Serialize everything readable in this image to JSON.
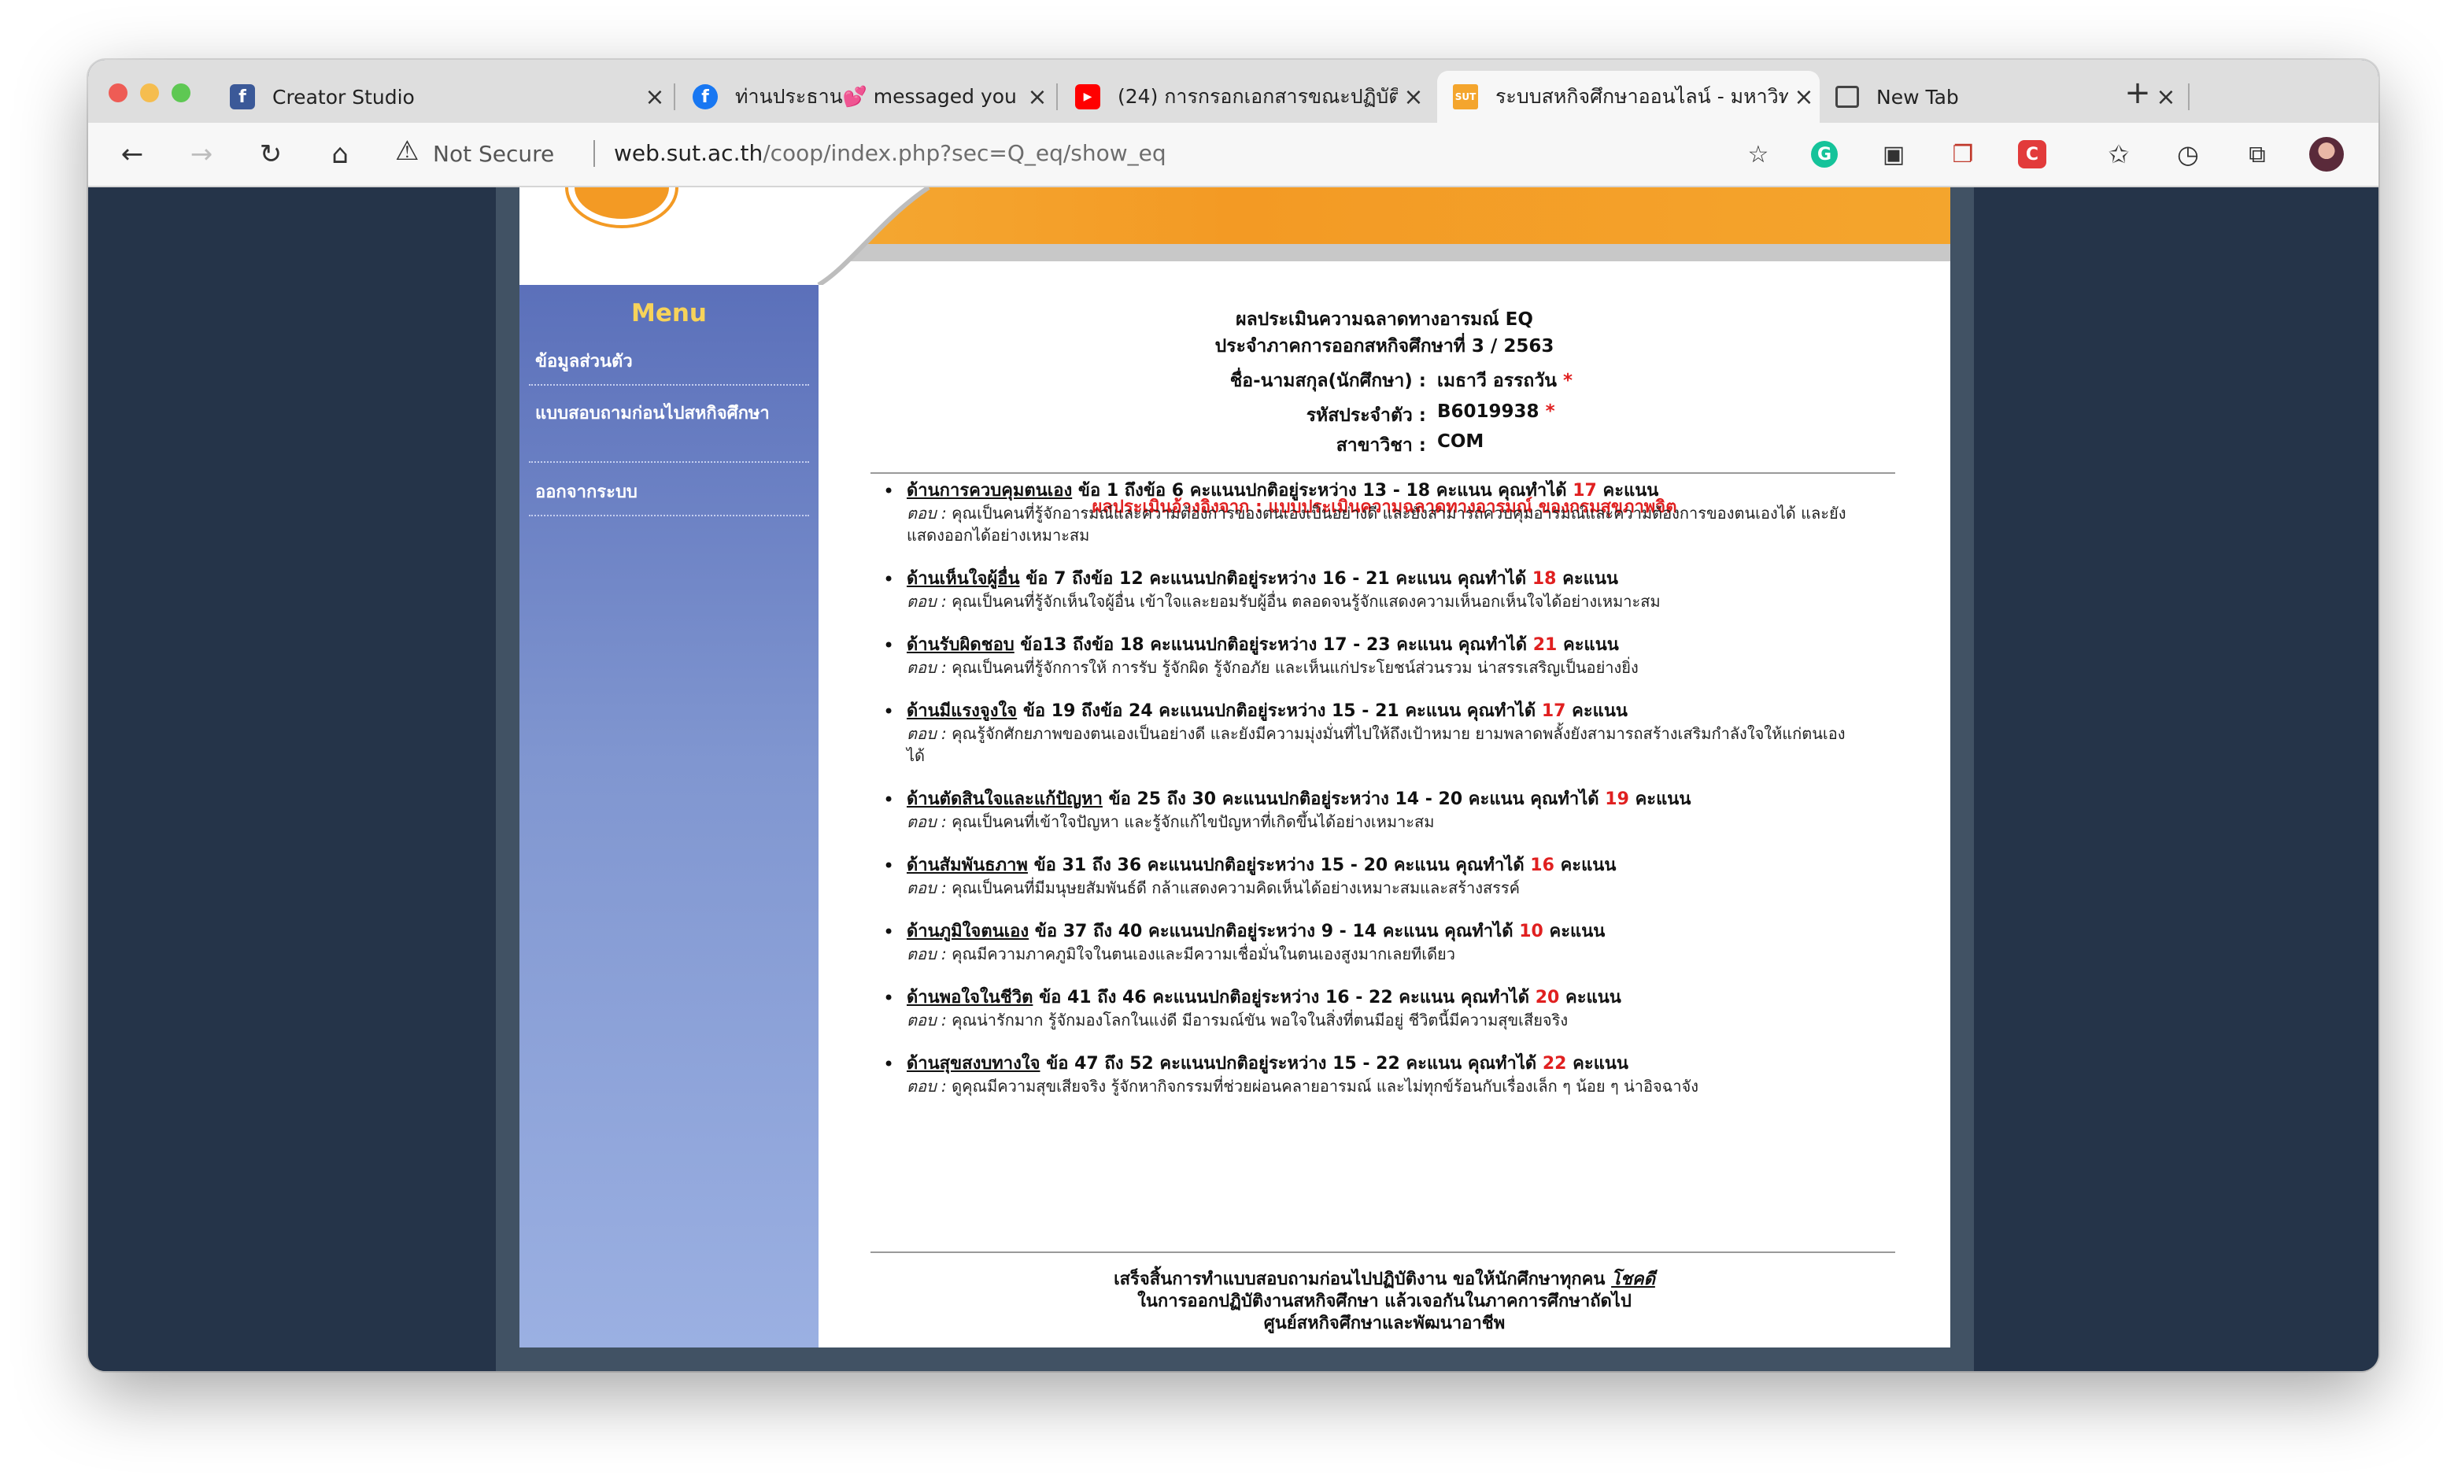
{
  "browser": {
    "tabs": [
      {
        "title": "Creator Studio",
        "icon": "facebook-icon"
      },
      {
        "title": "ท่านประธาน💕 messaged you",
        "icon": "facebook-icon"
      },
      {
        "title": "(24) การกรอกเอกสารขณะปฏิบัติงา",
        "icon": "youtube-icon"
      },
      {
        "title": "ระบบสหกิจศึกษาออนไลน์ - มหาวิท",
        "icon": "sut-icon"
      },
      {
        "title": "New Tab",
        "icon": "newtab-icon"
      }
    ],
    "security_label": "Not Secure",
    "url_domain": "web.sut.ac.th",
    "url_path": "/coop/index.php?sec=Q_eq/show_eq"
  },
  "sidebar": {
    "title": "Menu",
    "items": [
      "ข้อมูลส่วนตัว",
      "แบบสอบถามก่อนไปสหกิจศึกษา",
      "ออกจากระบบ"
    ]
  },
  "main": {
    "title": "ผลประเมินความฉลาดทางอารมณ์ EQ",
    "subtitle": "ประจำภาคการออกสหกิจศึกษาที่ 3 / 2563",
    "fields": [
      {
        "label": "ชื่อ-นามสกุล(นักศึกษา) :",
        "value": "เมธาวี อรรถวัน",
        "required": "*"
      },
      {
        "label": "รหัสประจำตัว :",
        "value": "B6019938",
        "required": "*"
      },
      {
        "label": "สาขาวิชา :",
        "value": "COM",
        "required": ""
      }
    ],
    "reference": "ผลประเมินอ้างอิงจาก : แบบประเมินความฉลาดทางอารมณ์ ของกรมสุขภาพจิต",
    "answer_prefix": "ตอบ :",
    "points_unit": "คะแนน",
    "results": [
      {
        "aspect": "ด้านการควบคุมตนเอง",
        "range_text": "ข้อ 1 ถึงข้อ 6 คะแนนปกติอยู่ระหว่าง 13 - 18 คะแนน คุณทำได้",
        "score": "17",
        "answer": "คุณเป็นคนที่รู้จักอารมณ์และความต้องการของตนเองเป็นอย่างดี และยังสามารถควบคุมอารมณ์และความต้องการของตนเองได้ และยังแสดงออกได้อย่างเหมาะสม"
      },
      {
        "aspect": "ด้านเห็นใจผู้อื่น",
        "range_text": "ข้อ 7 ถึงข้อ 12 คะแนนปกติอยู่ระหว่าง 16 - 21 คะแนน คุณทำได้",
        "score": "18",
        "answer": "คุณเป็นคนที่รู้จักเห็นใจผู้อื่น เข้าใจและยอมรับผู้อื่น ตลอดจนรู้จักแสดงความเห็นอกเห็นใจได้อย่างเหมาะสม"
      },
      {
        "aspect": "ด้านรับผิดชอบ",
        "range_text": "ข้อ13 ถึงข้อ 18 คะแนนปกติอยู่ระหว่าง 17 - 23 คะแนน คุณทำได้",
        "score": "21",
        "answer": "คุณเป็นคนที่รู้จักการให้ การรับ รู้จักผิด รู้จักอภัย และเห็นแก่ประโยชน์ส่วนรวม น่าสรรเสริญเป็นอย่างยิ่ง"
      },
      {
        "aspect": "ด้านมีแรงจูงใจ",
        "range_text": "ข้อ 19 ถึงข้อ 24 คะแนนปกติอยู่ระหว่าง 15 - 21 คะแนน คุณทำได้",
        "score": "17",
        "answer": "คุณรู้จักศักยภาพของตนเองเป็นอย่างดี และยังมีความมุ่งมั่นที่ไปให้ถึงเป้าหมาย ยามพลาดพลั้งยังสามารถสร้างเสริมกำลังใจให้แก่ตนเองได้"
      },
      {
        "aspect": "ด้านตัดสินใจและแก้ปัญหา",
        "range_text": "ข้อ 25 ถึง 30 คะแนนปกติอยู่ระหว่าง 14 - 20 คะแนน คุณทำได้",
        "score": "19",
        "answer": "คุณเป็นคนที่เข้าใจปัญหา และรู้จักแก้ไขปัญหาที่เกิดขึ้นได้อย่างเหมาะสม"
      },
      {
        "aspect": "ด้านสัมพันธภาพ",
        "range_text": "ข้อ 31 ถึง 36 คะแนนปกติอยู่ระหว่าง 15 - 20 คะแนน คุณทำได้",
        "score": "16",
        "answer": "คุณเป็นคนที่มีมนุษยสัมพันธ์ดี กล้าแสดงความคิดเห็นได้อย่างเหมาะสมและสร้างสรรค์"
      },
      {
        "aspect": "ด้านภูมิใจตนเอง",
        "range_text": "ข้อ 37 ถึง 40 คะแนนปกติอยู่ระหว่าง 9 - 14 คะแนน คุณทำได้",
        "score": "10",
        "answer": "คุณมีความภาคภูมิใจในตนเองและมีความเชื่อมั่นในตนเองสูงมากเลยทีเดียว"
      },
      {
        "aspect": "ด้านพอใจในชีวิต",
        "range_text": "ข้อ 41 ถึง 46 คะแนนปกติอยู่ระหว่าง 16 - 22 คะแนน คุณทำได้",
        "score": "20",
        "answer": "คุณน่ารักมาก รู้จักมองโลกในแง่ดี มีอารมณ์ขัน พอใจในสิ่งที่ตนมีอยู่ ชีวิตนี้มีความสุขเสียจริง"
      },
      {
        "aspect": "ด้านสุขสงบทางใจ",
        "range_text": "ข้อ 47 ถึง 52 คะแนนปกติอยู่ระหว่าง 15 - 22 คะแนน คุณทำได้",
        "score": "22",
        "answer": "ดูคุณมีความสุขเสียจริง รู้จักหากิจกรรมที่ช่วยผ่อนคลายอารมณ์ และไม่ทุกข์ร้อนกับเรื่องเล็ก ๆ น้อย ๆ น่าอิจฉาจัง"
      }
    ],
    "footer_line1_pre": "เสร็จสิ้นการทำแบบสอบถามก่อนไปปฏิบัติงาน ขอให้นักศึกษาทุกคน",
    "footer_line1_link": "โชคดี",
    "footer_line2": "ในการออกปฏิบัติงานสหกิจศึกษา แล้วเจอกันในภาคการศึกษาถัดไป",
    "footer_line3": "ศูนย์สหกิจศึกษาและพัฒนาอาชีพ"
  },
  "colors": {
    "accent_red": "#e02020",
    "menu_title": "#f7d35a",
    "page_bg": "#253449",
    "banner_orange": "#f4a52d"
  }
}
